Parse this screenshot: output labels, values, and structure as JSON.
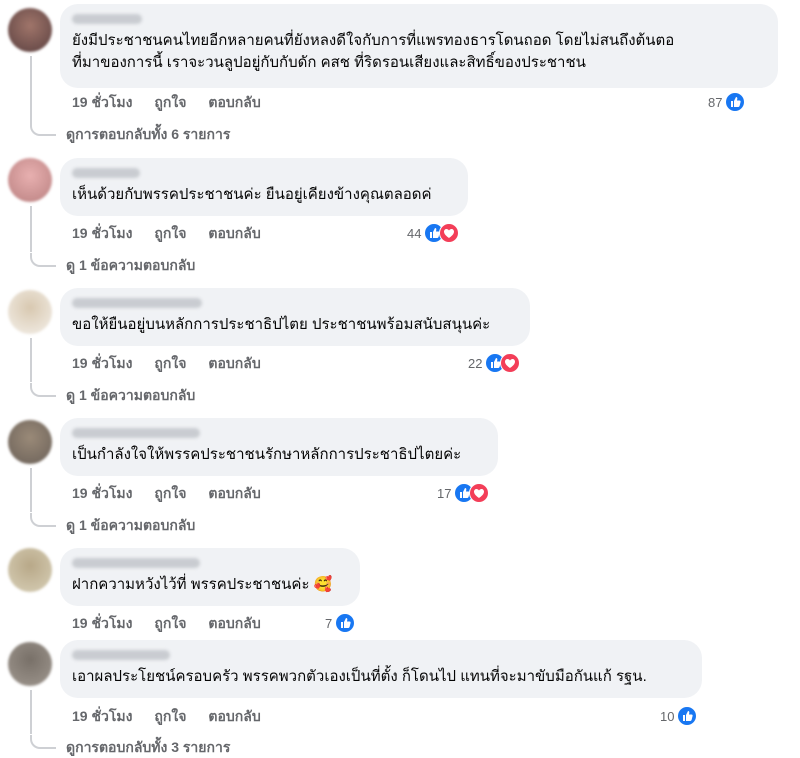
{
  "comments": [
    {
      "text_lines": [
        "ยังมีประชาชนคนไทยอีกหลายคนที่ยังหลงดีใจกับการที่แพรทองธารโดนถอด โดยไม่สนถึงต้นตอ",
        "ที่มาของการนี้ เราจะวนลูปอยู่กับกับดัก คสช ที่ริดรอนเสียงและสิทธิ์ของประชาชน"
      ],
      "time": "19 ชั่วโมง",
      "like": "ถูกใจ",
      "reply": "ตอบกลับ",
      "reaction_count": "87",
      "love": false,
      "replies_label": "ดูการตอบกลับทั้ง 6 รายการ"
    },
    {
      "text_lines": [
        "เห็นด้วยกับพรรคประชาชนค่ะ ยืนอยู่เคียงข้างคุณตลอดค่ "
      ],
      "time": "19 ชั่วโมง",
      "like": "ถูกใจ",
      "reply": "ตอบกลับ",
      "reaction_count": "44",
      "love": true,
      "replies_label": "ดู 1 ข้อความตอบกลับ"
    },
    {
      "text_lines": [
        "ขอให้ยืนอยู่บนหลักการประชาธิปไตย ประชาชนพร้อมสนับสนุนค่ะ"
      ],
      "time": "19 ชั่วโมง",
      "like": "ถูกใจ",
      "reply": "ตอบกลับ",
      "reaction_count": "22",
      "love": true,
      "replies_label": "ดู 1 ข้อความตอบกลับ"
    },
    {
      "text_lines": [
        "เป็นกำลังใจให้พรรคประชาชนรักษาหลักการประชาธิปไตยค่ะ"
      ],
      "time": "19 ชั่วโมง",
      "like": "ถูกใจ",
      "reply": "ตอบกลับ",
      "reaction_count": "17",
      "love": true,
      "replies_label": "ดู 1 ข้อความตอบกลับ"
    },
    {
      "text_lines": [
        "ฝากความหวังไว้ที่ พรรคประชาชนค่ะ 🥰"
      ],
      "time": "19 ชั่วโมง",
      "like": "ถูกใจ",
      "reply": "ตอบกลับ",
      "reaction_count": "7",
      "love": false,
      "replies_label": ""
    },
    {
      "text_lines": [
        "เอาผลประโยชน์ครอบครัว พรรคพวกตัวเองเป็นที่ตั้ง ก็โดนไป แทนที่จะมาขับมือกันแก้ รฐน."
      ],
      "time": "19 ชั่วโมง",
      "like": "ถูกใจ",
      "reply": "ตอบกลับ",
      "reaction_count": "10",
      "love": false,
      "replies_label": "ดูการตอบกลับทั้ง 3 รายการ"
    }
  ],
  "colors": {
    "like": "#1877f2",
    "love": "#f33e58",
    "bubble": "#f0f2f5",
    "meta": "#65676b"
  },
  "icons": {
    "like": "thumbs-up-icon",
    "love": "heart-icon"
  }
}
